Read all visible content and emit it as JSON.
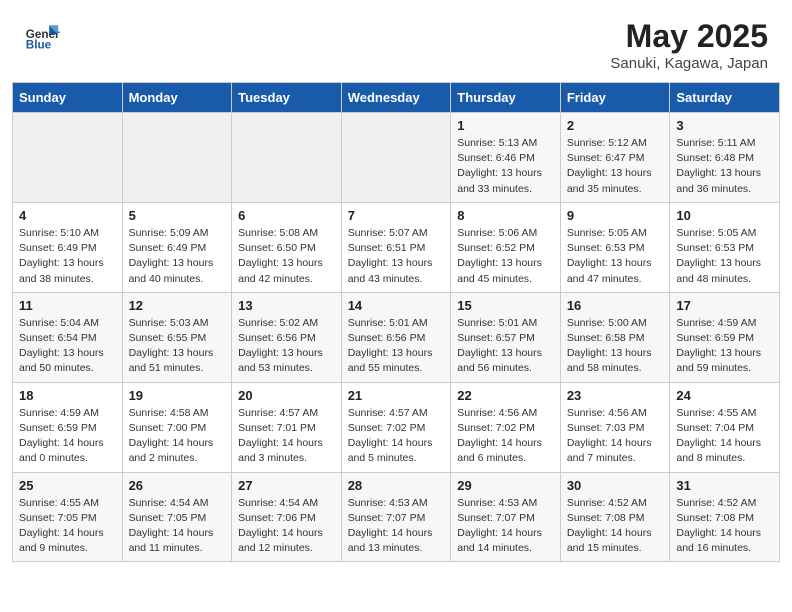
{
  "header": {
    "logo_general": "General",
    "logo_blue": "Blue",
    "title": "May 2025",
    "location": "Sanuki, Kagawa, Japan"
  },
  "days_of_week": [
    "Sunday",
    "Monday",
    "Tuesday",
    "Wednesday",
    "Thursday",
    "Friday",
    "Saturday"
  ],
  "weeks": [
    [
      {
        "day": "",
        "content": ""
      },
      {
        "day": "",
        "content": ""
      },
      {
        "day": "",
        "content": ""
      },
      {
        "day": "",
        "content": ""
      },
      {
        "day": "1",
        "content": "Sunrise: 5:13 AM\nSunset: 6:46 PM\nDaylight: 13 hours\nand 33 minutes."
      },
      {
        "day": "2",
        "content": "Sunrise: 5:12 AM\nSunset: 6:47 PM\nDaylight: 13 hours\nand 35 minutes."
      },
      {
        "day": "3",
        "content": "Sunrise: 5:11 AM\nSunset: 6:48 PM\nDaylight: 13 hours\nand 36 minutes."
      }
    ],
    [
      {
        "day": "4",
        "content": "Sunrise: 5:10 AM\nSunset: 6:49 PM\nDaylight: 13 hours\nand 38 minutes."
      },
      {
        "day": "5",
        "content": "Sunrise: 5:09 AM\nSunset: 6:49 PM\nDaylight: 13 hours\nand 40 minutes."
      },
      {
        "day": "6",
        "content": "Sunrise: 5:08 AM\nSunset: 6:50 PM\nDaylight: 13 hours\nand 42 minutes."
      },
      {
        "day": "7",
        "content": "Sunrise: 5:07 AM\nSunset: 6:51 PM\nDaylight: 13 hours\nand 43 minutes."
      },
      {
        "day": "8",
        "content": "Sunrise: 5:06 AM\nSunset: 6:52 PM\nDaylight: 13 hours\nand 45 minutes."
      },
      {
        "day": "9",
        "content": "Sunrise: 5:05 AM\nSunset: 6:53 PM\nDaylight: 13 hours\nand 47 minutes."
      },
      {
        "day": "10",
        "content": "Sunrise: 5:05 AM\nSunset: 6:53 PM\nDaylight: 13 hours\nand 48 minutes."
      }
    ],
    [
      {
        "day": "11",
        "content": "Sunrise: 5:04 AM\nSunset: 6:54 PM\nDaylight: 13 hours\nand 50 minutes."
      },
      {
        "day": "12",
        "content": "Sunrise: 5:03 AM\nSunset: 6:55 PM\nDaylight: 13 hours\nand 51 minutes."
      },
      {
        "day": "13",
        "content": "Sunrise: 5:02 AM\nSunset: 6:56 PM\nDaylight: 13 hours\nand 53 minutes."
      },
      {
        "day": "14",
        "content": "Sunrise: 5:01 AM\nSunset: 6:56 PM\nDaylight: 13 hours\nand 55 minutes."
      },
      {
        "day": "15",
        "content": "Sunrise: 5:01 AM\nSunset: 6:57 PM\nDaylight: 13 hours\nand 56 minutes."
      },
      {
        "day": "16",
        "content": "Sunrise: 5:00 AM\nSunset: 6:58 PM\nDaylight: 13 hours\nand 58 minutes."
      },
      {
        "day": "17",
        "content": "Sunrise: 4:59 AM\nSunset: 6:59 PM\nDaylight: 13 hours\nand 59 minutes."
      }
    ],
    [
      {
        "day": "18",
        "content": "Sunrise: 4:59 AM\nSunset: 6:59 PM\nDaylight: 14 hours\nand 0 minutes."
      },
      {
        "day": "19",
        "content": "Sunrise: 4:58 AM\nSunset: 7:00 PM\nDaylight: 14 hours\nand 2 minutes."
      },
      {
        "day": "20",
        "content": "Sunrise: 4:57 AM\nSunset: 7:01 PM\nDaylight: 14 hours\nand 3 minutes."
      },
      {
        "day": "21",
        "content": "Sunrise: 4:57 AM\nSunset: 7:02 PM\nDaylight: 14 hours\nand 5 minutes."
      },
      {
        "day": "22",
        "content": "Sunrise: 4:56 AM\nSunset: 7:02 PM\nDaylight: 14 hours\nand 6 minutes."
      },
      {
        "day": "23",
        "content": "Sunrise: 4:56 AM\nSunset: 7:03 PM\nDaylight: 14 hours\nand 7 minutes."
      },
      {
        "day": "24",
        "content": "Sunrise: 4:55 AM\nSunset: 7:04 PM\nDaylight: 14 hours\nand 8 minutes."
      }
    ],
    [
      {
        "day": "25",
        "content": "Sunrise: 4:55 AM\nSunset: 7:05 PM\nDaylight: 14 hours\nand 9 minutes."
      },
      {
        "day": "26",
        "content": "Sunrise: 4:54 AM\nSunset: 7:05 PM\nDaylight: 14 hours\nand 11 minutes."
      },
      {
        "day": "27",
        "content": "Sunrise: 4:54 AM\nSunset: 7:06 PM\nDaylight: 14 hours\nand 12 minutes."
      },
      {
        "day": "28",
        "content": "Sunrise: 4:53 AM\nSunset: 7:07 PM\nDaylight: 14 hours\nand 13 minutes."
      },
      {
        "day": "29",
        "content": "Sunrise: 4:53 AM\nSunset: 7:07 PM\nDaylight: 14 hours\nand 14 minutes."
      },
      {
        "day": "30",
        "content": "Sunrise: 4:52 AM\nSunset: 7:08 PM\nDaylight: 14 hours\nand 15 minutes."
      },
      {
        "day": "31",
        "content": "Sunrise: 4:52 AM\nSunset: 7:08 PM\nDaylight: 14 hours\nand 16 minutes."
      }
    ]
  ]
}
